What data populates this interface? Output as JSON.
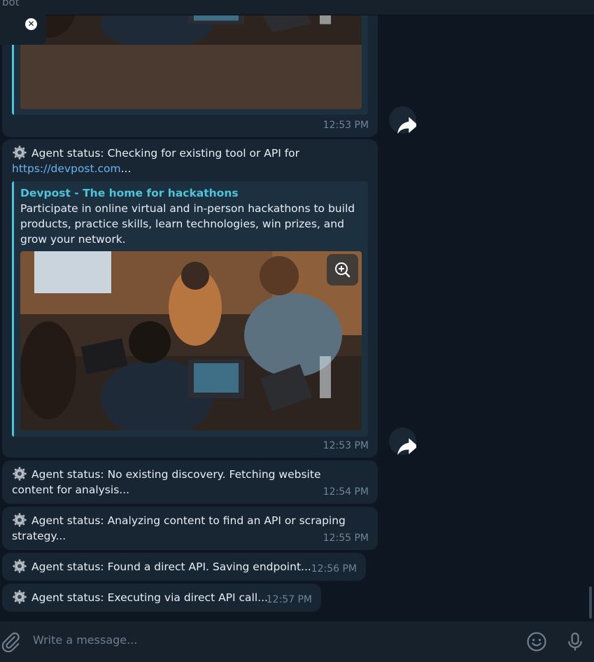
{
  "header": {
    "title": "bot"
  },
  "messages": [
    {
      "id": "m1",
      "text": "",
      "time": "12:53 PM"
    },
    {
      "id": "m2",
      "text_prefix": "Agent status: Checking for existing tool or API for",
      "link": "https://devpost.com",
      "text_suffix": "...",
      "preview": {
        "title": "Devpost - The home for hackathons",
        "description": "Participate in online virtual and in-person hackathons to build products, practice skills, learn technologies, win prizes, and grow your network."
      },
      "time": "12:53 PM"
    },
    {
      "id": "m3",
      "text": "Agent status: No existing discovery. Fetching website content for analysis...",
      "time": "12:54 PM"
    },
    {
      "id": "m4",
      "text": "Agent status: Analyzing content to find an API or scraping strategy...",
      "time": "12:55 PM"
    },
    {
      "id": "m5",
      "text": "Agent status: Found a direct API. Saving endpoint...",
      "time": "12:56 PM"
    },
    {
      "id": "m6",
      "text": "Agent status: Executing via direct API call...",
      "time": "12:57 PM"
    }
  ],
  "composer": {
    "placeholder": "Write a message..."
  },
  "icons": {
    "gear": "gear-icon",
    "share": "share-icon",
    "zoom": "zoom-in-icon",
    "attach": "paperclip-icon",
    "emoji": "emoji-icon",
    "mic": "microphone-icon",
    "close": "close-icon"
  },
  "colors": {
    "link": "#6ab3f3",
    "accent": "#4fc3d9",
    "bubble": "#182533",
    "background": "#0e1621"
  }
}
